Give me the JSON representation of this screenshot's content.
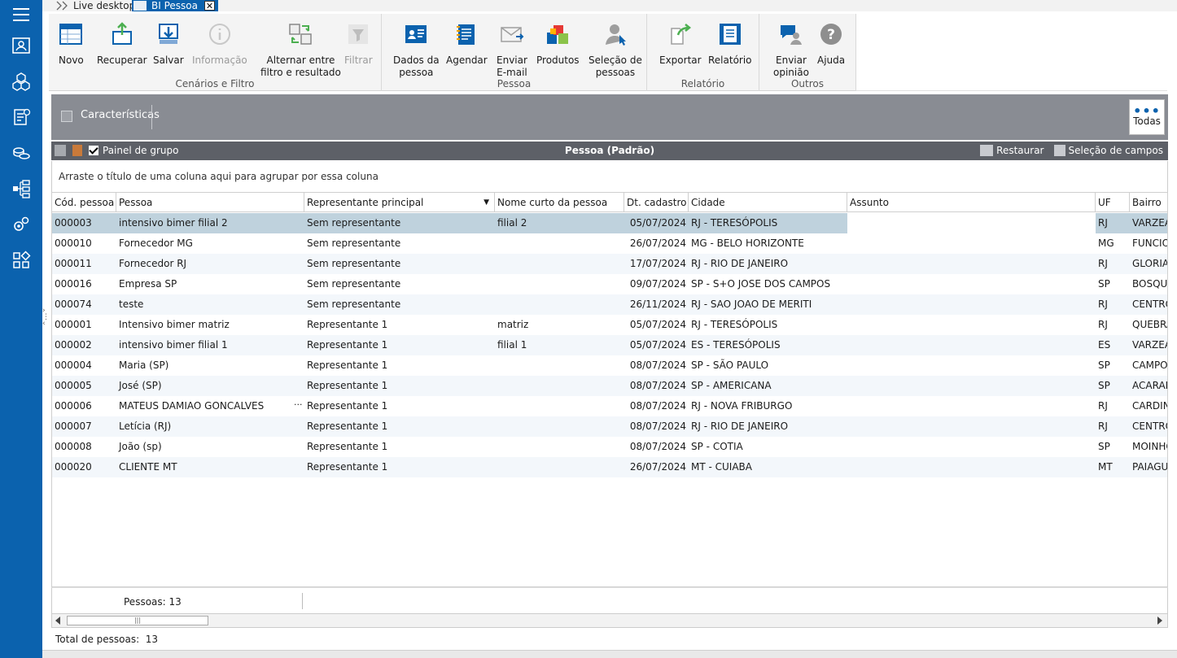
{
  "tabs": [
    {
      "label": "Live desktop"
    },
    {
      "label": "BI Pessoa"
    }
  ],
  "ribbon": {
    "groups": [
      {
        "label": "Cenários e Filtro",
        "buttons": [
          "Novo",
          "Recuperar",
          "Salvar",
          "Informação",
          "Alternar entre\nfiltro e resultado",
          "Filtrar"
        ]
      },
      {
        "label": "Pessoa",
        "buttons": [
          "Dados da\npessoa",
          "Agendar",
          "Enviar\nE-mail",
          "Produtos",
          "Seleção de\npessoas"
        ]
      },
      {
        "label": "Relatório",
        "buttons": [
          "Exportar",
          "Relatório"
        ]
      },
      {
        "label": "Outros",
        "buttons": [
          "Enviar\nopinião",
          "Ajuda"
        ]
      }
    ]
  },
  "filter": {
    "label": "Características",
    "todas": "Todas"
  },
  "gridbar": {
    "group_panel": "Painel de grupo",
    "title": "Pessoa (Padrão)",
    "restore": "Restaurar",
    "field_selection": "Seleção de campos"
  },
  "group_hint": "Arraste o título de uma coluna aqui para agrupar por essa coluna",
  "columns": [
    "Cód. pessoa",
    "Pessoa",
    "Representante principal",
    "Nome curto da pessoa",
    "Dt. cadastro",
    "Cidade",
    "Assunto",
    "UF",
    "Bairro"
  ],
  "rows": [
    {
      "cod": "000003",
      "pessoa": "intensivo bimer filial 2",
      "rep": "Sem representante",
      "curto": "filial 2",
      "dt": "05/07/2024",
      "cidade": "RJ - TERESÓPOLIS",
      "assunto": "",
      "uf": "RJ",
      "bairro": "VARZEA"
    },
    {
      "cod": "000010",
      "pessoa": "Fornecedor MG",
      "rep": "Sem representante",
      "curto": "",
      "dt": "26/07/2024",
      "cidade": "MG - BELO HORIZONTE",
      "assunto": "",
      "uf": "MG",
      "bairro": "FUNCIOI"
    },
    {
      "cod": "000011",
      "pessoa": "Fornecedor RJ",
      "rep": "Sem representante",
      "curto": "",
      "dt": "17/07/2024",
      "cidade": "RJ - RIO DE JANEIRO",
      "assunto": "",
      "uf": "RJ",
      "bairro": "GLORIA"
    },
    {
      "cod": "000016",
      "pessoa": "Empresa SP",
      "rep": "Sem representante",
      "curto": "",
      "dt": "09/07/2024",
      "cidade": "SP - S+O JOSE DOS CAMPOS",
      "assunto": "",
      "uf": "SP",
      "bairro": "BOSQUE"
    },
    {
      "cod": "000074",
      "pessoa": "teste",
      "rep": "Sem representante",
      "curto": "",
      "dt": "26/11/2024",
      "cidade": "RJ - SAO JOAO DE MERITI",
      "assunto": "",
      "uf": "RJ",
      "bairro": "CENTRO"
    },
    {
      "cod": "000001",
      "pessoa": "Intensivo bimer matriz",
      "rep": "Representante 1",
      "curto": "matriz",
      "dt": "05/07/2024",
      "cidade": "RJ - TERESÓPOLIS",
      "assunto": "",
      "uf": "RJ",
      "bairro": "QUEBRA"
    },
    {
      "cod": "000002",
      "pessoa": "intensivo bimer filial 1",
      "rep": "Representante 1",
      "curto": "filial 1",
      "dt": "05/07/2024",
      "cidade": "ES - TERESÓPOLIS",
      "assunto": "",
      "uf": "ES",
      "bairro": "VARZEA"
    },
    {
      "cod": "000004",
      "pessoa": "Maria (SP)",
      "rep": "Representante 1",
      "curto": "",
      "dt": "08/07/2024",
      "cidade": "SP - SÃO PAULO",
      "assunto": "",
      "uf": "SP",
      "bairro": "CAMPO"
    },
    {
      "cod": "000005",
      "pessoa": "José (SP)",
      "rep": "Representante 1",
      "curto": "",
      "dt": "08/07/2024",
      "cidade": "SP - AMERICANA",
      "assunto": "",
      "uf": "SP",
      "bairro": "ACARAI"
    },
    {
      "cod": "000006",
      "pessoa": "MATEUS DAMIAO GONCALVES",
      "rep": "Representante 1",
      "curto": "",
      "dt": "08/07/2024",
      "cidade": "RJ - NOVA FRIBURGO",
      "assunto": "",
      "uf": "RJ",
      "bairro": "CARDIN"
    },
    {
      "cod": "000007",
      "pessoa": "Letícia (RJ)",
      "rep": "Representante 1",
      "curto": "",
      "dt": "08/07/2024",
      "cidade": "RJ - RIO DE JANEIRO",
      "assunto": "",
      "uf": "RJ",
      "bairro": "CENTRO"
    },
    {
      "cod": "000008",
      "pessoa": "João (sp)",
      "rep": "Representante 1",
      "curto": "",
      "dt": "08/07/2024",
      "cidade": "SP - COTIA",
      "assunto": "",
      "uf": "SP",
      "bairro": "MOINHO"
    },
    {
      "cod": "000020",
      "pessoa": "CLIENTE MT",
      "rep": "Representante 1",
      "curto": "",
      "dt": "26/07/2024",
      "cidade": "MT - CUIABA",
      "assunto": "",
      "uf": "MT",
      "bairro": "PAIAGUA"
    }
  ],
  "summary": {
    "pessoas": "Pessoas: 13"
  },
  "total": {
    "label": "Total de pessoas:",
    "value": "13"
  },
  "colors": {
    "sidebar": "#0b62ae",
    "selected_row": "#bfd2dd",
    "filter_bar": "#898c93",
    "grid_bar": "#5d6067"
  }
}
